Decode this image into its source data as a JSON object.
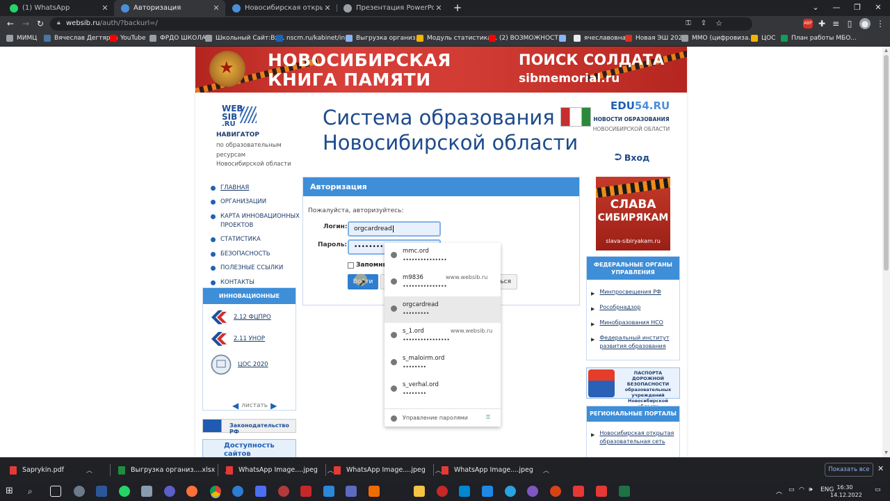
{
  "browser": {
    "tabs": [
      {
        "title": "(1) WhatsApp",
        "color": "#25d366"
      },
      {
        "title": "Авторизация",
        "color": "#4a90d9"
      },
      {
        "title": "Новосибирская открытая обра",
        "color": "#4a90d9"
      },
      {
        "title": "Презентация PowerPoint",
        "color": "#e8eaed"
      }
    ],
    "active_tab": 1,
    "url_host": "websib.ru",
    "url_path": "/auth/?backurl=/",
    "bookmarks": [
      {
        "label": "МИМЦ",
        "color": "#9aa0a6"
      },
      {
        "label": "Вячеслав Дегтярев",
        "color": "#4c75a3"
      },
      {
        "label": "YouTube",
        "color": "#ff0000"
      },
      {
        "label": "ФРДО ШКОЛА",
        "color": "#9aa0a6"
      },
      {
        "label": "Школьный Сайт:Вх...",
        "color": "#9aa0a6"
      },
      {
        "label": "nscm.ru/kabinet/in...",
        "color": "#1e63b5"
      },
      {
        "label": "Выгрузка организ...",
        "color": "#8ab4f8"
      },
      {
        "label": "Модуль статистика...",
        "color": "#f4b400"
      },
      {
        "label": "(2) ВОЗМОЖНОСТ...",
        "color": "#ff0000"
      },
      {
        "label": "",
        "color": "#8ab4f8"
      },
      {
        "label": "ячеславовна",
        "color": "#e8eaed"
      },
      {
        "label": "Новая ЭШ 2021",
        "color": "#d93025"
      },
      {
        "label": "ММО (цифровиза...",
        "color": "#9aa0a6"
      },
      {
        "label": "ЦОС",
        "color": "#f4b400"
      },
      {
        "label": "План работы МБО...",
        "color": "#0f9d58"
      }
    ]
  },
  "site": {
    "banner": {
      "line1": "НОВОСИБИРСКАЯ",
      "line2": "КНИГА ПАМЯТИ",
      "right1": "ПОИСК СОЛДАТА",
      "right2": "sibmemorial.ru"
    },
    "nav_logo": {
      "l1": "WEB",
      "l2": "SIB",
      "l3": ".RU"
    },
    "nav_title": "НАВИГАТОР",
    "nav_subtitle": "по образовательным ресурсам Новосибирской области",
    "system_title_1": "Система образования",
    "system_title_2": "Новосибирской области",
    "edu_logo_a": "EDU",
    "edu_logo_b": "54.RU",
    "edu_news": "НОВОСТИ ОБРАЗОВАНИЯ",
    "edu_sub": "НОВОСИБИРСКОЙ ОБЛАСТИ",
    "login_link": "Вход",
    "menu": [
      "ГЛАВНАЯ",
      "ОРГАНИЗАЦИИ",
      "КАРТА ИННОВАЦИОННЫХ ПРОЕКТОВ",
      "СТАТИСТИКА",
      "БЕЗОПАСНОСТЬ",
      "ПОЛЕЗНЫЕ ССЫЛКИ",
      "КОНТАКТЫ"
    ],
    "innovations": {
      "title": "ИННОВАЦИОННЫЕ ПРОЕКТЫ",
      "items": [
        "2.12 ФЦПРО",
        "2.11 УНОР",
        "ЦОС 2020"
      ],
      "nav_label": "листать"
    },
    "law_banner": "Законодательство РФ",
    "access_banner": "Доступность сайтов образовательны",
    "auth": {
      "title": "Авторизация",
      "prompt": "Пожалуйста, авторизуйтесь:",
      "login_label": "Логин:",
      "login_value": "orgcardread",
      "password_label": "Пароль:",
      "password_value": "•••••••••••",
      "remember_label": "Запомни",
      "login_button": "Войти",
      "register_button": "ться"
    },
    "autofill": {
      "items": [
        {
          "user": "mmc.ord",
          "pass": "•••••••••••••••",
          "site": ""
        },
        {
          "user": "m9836",
          "pass": "•••••••••••••••",
          "site": "www.websib.ru"
        },
        {
          "user": "orgcardread",
          "pass": "•••••••••",
          "site": ""
        },
        {
          "user": "s_1.ord",
          "pass": "••••••••••••••••",
          "site": "www.websib.ru"
        },
        {
          "user": "s_maloirm.ord",
          "pass": "••••••••",
          "site": ""
        },
        {
          "user": "s_verhal.ord",
          "pass": "••••••••",
          "site": ""
        }
      ],
      "selected_index": 2,
      "manage_label": "Управление паролями"
    },
    "slava": {
      "line1": "СЛАВА",
      "line2": "СИБИРЯКАМ",
      "url": "slava-sibiryakam.ru"
    },
    "federal": {
      "title": "ФЕДЕРАЛЬНЫЕ ОРГАНЫ УПРАВЛЕНИЯ",
      "items": [
        "Минпросвещения РФ",
        "Рособрнадзор",
        "Минобразования НСО",
        "Федеральный институт развития образования"
      ]
    },
    "passport": "ПАСПОРТА ДОРОЖНОЙ БЕЗОПАСНОСТИ образовательных учреждений Новосибирской области",
    "regional": {
      "title": "РЕГИОНАЛЬНЫЕ ПОРТАЛЫ",
      "items": [
        "Новосибирская открытая образовательная сеть"
      ]
    }
  },
  "downloads": [
    {
      "name": "Saprykin.pdf",
      "color": "#e53935"
    },
    {
      "name": "Выгрузка организ....xlsx",
      "color": "#1e8e3e"
    },
    {
      "name": "WhatsApp Image....jpeg",
      "color": "#e53935"
    },
    {
      "name": "WhatsApp Image....jpeg",
      "color": "#e53935"
    },
    {
      "name": "WhatsApp Image....jpeg",
      "color": "#e53935"
    }
  ],
  "show_all": "Показать все",
  "taskbar": {
    "lang": "ENG",
    "time": "16:30",
    "date": "14.12.2022"
  }
}
